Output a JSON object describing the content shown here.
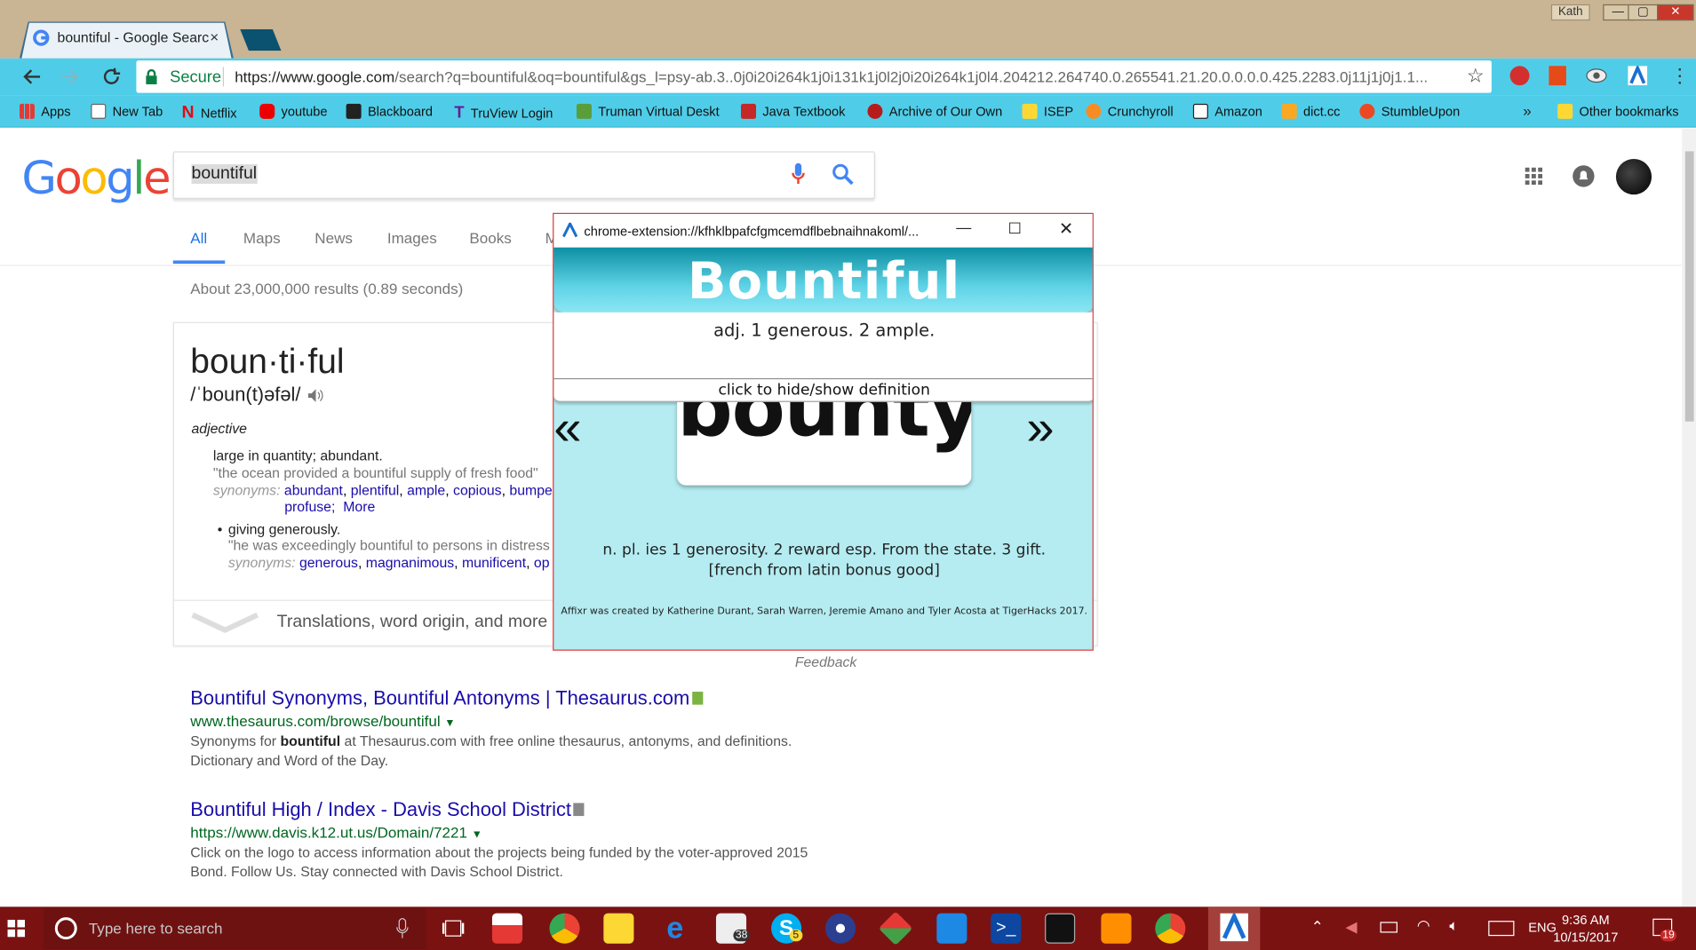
{
  "browser": {
    "tab_title": "bountiful - Google Searc",
    "tab_close": "×",
    "profile": "Kath",
    "win_min": "—",
    "win_max": "▢",
    "win_close": "✕",
    "secure_label": "Secure",
    "url_host": "https://www.google.com",
    "url_path": "/search?q=bountiful&oq=bountiful&gs_l=psy-ab.3..0j0i20i264k1j0i131k1j0l2j0i20i264k1j0l4.204212.264740.0.265541.21.20.0.0.0.0.425.2283.0j11j1j0j1.1...",
    "bookmarks": [
      "Apps",
      "New Tab",
      "Netflix",
      "youtube",
      "Blackboard",
      "TruView Login",
      "Truman Virtual Deskt",
      "Java Textbook",
      "Archive of Our Own",
      "ISEP",
      "Crunchyroll",
      "Amazon",
      "dict.cc",
      "StumbleUpon"
    ],
    "more_bookmarks": "»",
    "other_bookmarks": "Other bookmarks"
  },
  "google": {
    "query": "bountiful",
    "tabs": [
      "All",
      "Maps",
      "News",
      "Images",
      "Books",
      "M"
    ],
    "result_count": "About 23,000,000 results (0.89 seconds)",
    "dictionary": {
      "word": "boun·ti·ful",
      "phonetic": "/ˈboun(t)əfəl/",
      "part_of_speech": "adjective",
      "def1": "large in quantity; abundant.",
      "example1": "\"the ocean provided a bountiful supply of fresh food\"",
      "synonyms_label": "synonyms:",
      "syn1": [
        "abundant",
        "plentiful",
        "ample",
        "copious",
        "bumpe"
      ],
      "syn1b": "profuse;",
      "more": "More",
      "def2": "giving generously.",
      "example2": "\"he was exceedingly bountiful to persons in distress",
      "syn2": [
        "generous",
        "magnanimous",
        "munificent",
        "op"
      ],
      "translations": "Translations, word origin, and more"
    },
    "feedback": "Feedback",
    "results": [
      {
        "title": "Bountiful Synonyms, Bountiful Antonyms | Thesaurus.com",
        "url": "www.thesaurus.com/browse/bountiful",
        "snippet_pre": "Synonyms for ",
        "snippet_bold": "bountiful",
        "snippet_post": " at Thesaurus.com with free online thesaurus, antonyms, and definitions.",
        "snippet_line2": "Dictionary and Word of the Day."
      },
      {
        "title": "Bountiful High / Index - Davis School District",
        "url": "https://www.davis.k12.ut.us/Domain/7221",
        "snippet_line1": "Click on the logo to access information about the projects being funded by the voter-approved 2015",
        "snippet_line2": "Bond. Follow Us. Stay connected with Davis School District."
      }
    ]
  },
  "popup": {
    "url": "chrome-extension://kfhklbpafcfgmcemdflbebnaihnakoml/...",
    "word": "Bountiful",
    "definition": "adj. 1 generous. 2 ample.",
    "toggle": "click to hide/show definition",
    "root_word": "bounty",
    "prev": "«",
    "next": "»",
    "root_def": "n. pl. ies 1 generosity. 2 reward esp. From the state. 3 gift. [french from latin bonus good]",
    "credit": "Affixr was created by Katherine Durant, Sarah Warren, Jeremie Amano and Tyler Acosta at TigerHacks 2017."
  },
  "taskbar": {
    "search_placeholder": "Type here to search",
    "mail_badge": "38",
    "skype_badge": "5",
    "lang": "ENG",
    "time": "9:36 AM",
    "date": "10/15/2017",
    "notif_badge": "19"
  },
  "colors": {
    "toolbar": "#4fcde8",
    "taskbar": "#7a1212",
    "popup_bg": "#b4ecf1",
    "link": "#1a0dab",
    "url_green": "#006621"
  }
}
